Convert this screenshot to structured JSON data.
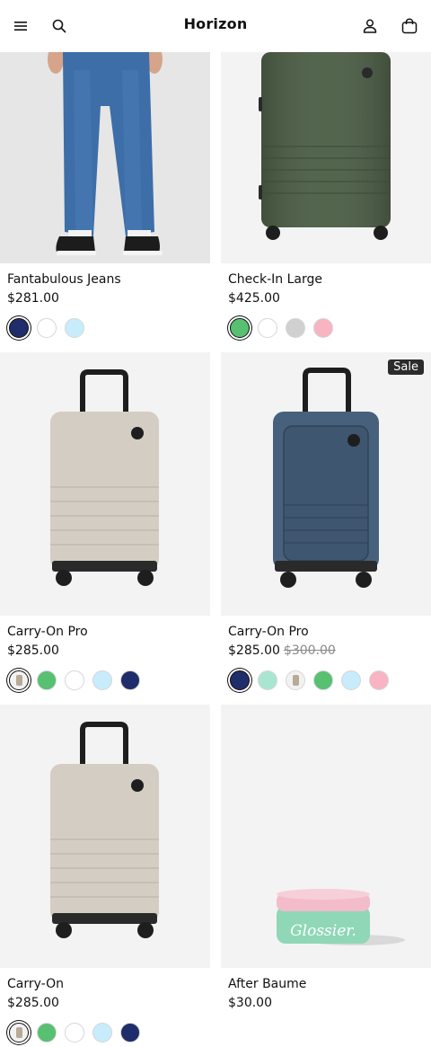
{
  "header": {
    "brand": "Horizon",
    "menu_icon": "menu-icon",
    "search_icon": "search-icon",
    "account_icon": "account-icon",
    "cart_icon": "shopping-bag-icon"
  },
  "products": [
    {
      "title": "Fantabulous Jeans",
      "price": "$281.00",
      "swatches": [
        {
          "color": "#1f2d6b",
          "selected": true
        },
        {
          "color": "#ffffff",
          "selected": false
        },
        {
          "color": "#c8ecfb",
          "selected": false
        }
      ]
    },
    {
      "title": "Check-In Large",
      "price": "$425.00",
      "swatches": [
        {
          "color": "#58c071",
          "selected": true
        },
        {
          "color": "#ffffff",
          "selected": false
        },
        {
          "color": "#d0d0d0",
          "selected": false
        },
        {
          "color": "#f8b4c3",
          "selected": false
        }
      ]
    },
    {
      "title": "Carry-On Pro",
      "price": "$285.00",
      "swatches": [
        {
          "color": "image",
          "selected": true
        },
        {
          "color": "#58c071",
          "selected": false
        },
        {
          "color": "#ffffff",
          "selected": false
        },
        {
          "color": "#c8ecfb",
          "selected": false
        },
        {
          "color": "#1f2d6b",
          "selected": false
        }
      ]
    },
    {
      "title": "Carry-On Pro",
      "price": "$285.00",
      "compare_price": "$300.00",
      "badge": "Sale",
      "swatches": [
        {
          "color": "#1f2d6b",
          "selected": true
        },
        {
          "color": "#a9e6d2",
          "selected": false
        },
        {
          "color": "image",
          "selected": false
        },
        {
          "color": "#58c071",
          "selected": false
        },
        {
          "color": "#c8ecfb",
          "selected": false
        },
        {
          "color": "#f8b4c3",
          "selected": false
        }
      ]
    },
    {
      "title": "Carry-On",
      "price": "$285.00",
      "swatches": [
        {
          "color": "image",
          "selected": true
        },
        {
          "color": "#58c071",
          "selected": false
        },
        {
          "color": "#ffffff",
          "selected": false
        },
        {
          "color": "#c8ecfb",
          "selected": false
        },
        {
          "color": "#1f2d6b",
          "selected": false
        }
      ]
    },
    {
      "title": "After Baume",
      "price": "$30.00",
      "jar_label": "Glossier.",
      "swatches": []
    }
  ]
}
